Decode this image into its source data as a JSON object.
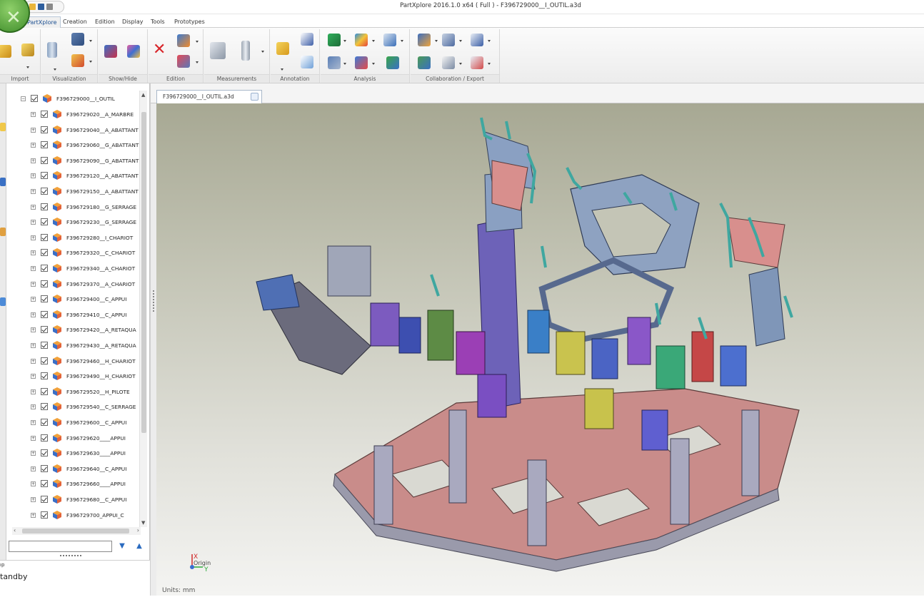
{
  "titlebar": {
    "title": "PartXplore 2016.1.0 x64 ( Full ) - F396729000__I_OUTIL.a3d"
  },
  "tabs": [
    "PartXplore",
    "Creation",
    "Edition",
    "Display",
    "Tools",
    "Prototypes"
  ],
  "active_tab": "PartXplore",
  "ribbon_groups": [
    "Import",
    "Visualization",
    "Show/Hide",
    "Edition",
    "Measurements",
    "Annotation",
    "Analysis",
    "Collaboration / Export"
  ],
  "tree": {
    "root": "F396729000__I_OUTIL",
    "items": [
      "F396729020__A_MARBRE",
      "F396729040__A_ABATTANT",
      "F396729060__G_ABATTANT",
      "F396729090__G_ABATTANT",
      "F396729120__A_ABATTANT",
      "F396729150__A_ABATTANT",
      "F396729180__G_SERRAGE",
      "F396729230__G_SERRAGE",
      "F396729280__I_CHARIOT",
      "F396729320__C_CHARIOT",
      "F396729340__A_CHARIOT",
      "F396729370__A_CHARIOT",
      "F396729400__C_APPUI",
      "F396729410__C_APPUI",
      "F396729420__A_RETAQUA",
      "F396729430__A_RETAQUA",
      "F396729460__H_CHARIOT",
      "F396729490__H_CHARIOT",
      "F396729520__H_PILOTE",
      "F396729540__C_SERRAGE",
      "F396729600__C_APPUI",
      "F396729620____APPUI",
      "F396729630____APPUI",
      "F396729640__C_APPUI",
      "F396729660____APPUI",
      "F396729680__C_APPUI",
      "F396729700_APPUI_C"
    ]
  },
  "search": {
    "value": ""
  },
  "status": {
    "small": "ıp",
    "text": "tandby"
  },
  "doc_tab": "F396729000__I_OUTIL.a3d",
  "viewport": {
    "axis_x": "X",
    "axis_y": "Y",
    "origin": "Origin",
    "units": "Units: mm"
  },
  "colors": {
    "accent": "#1b4f91",
    "orb": "#5aa63a",
    "base_plate": "#c98c8a",
    "frame": "#7f96b8",
    "clamps": "#3fa7a0"
  }
}
